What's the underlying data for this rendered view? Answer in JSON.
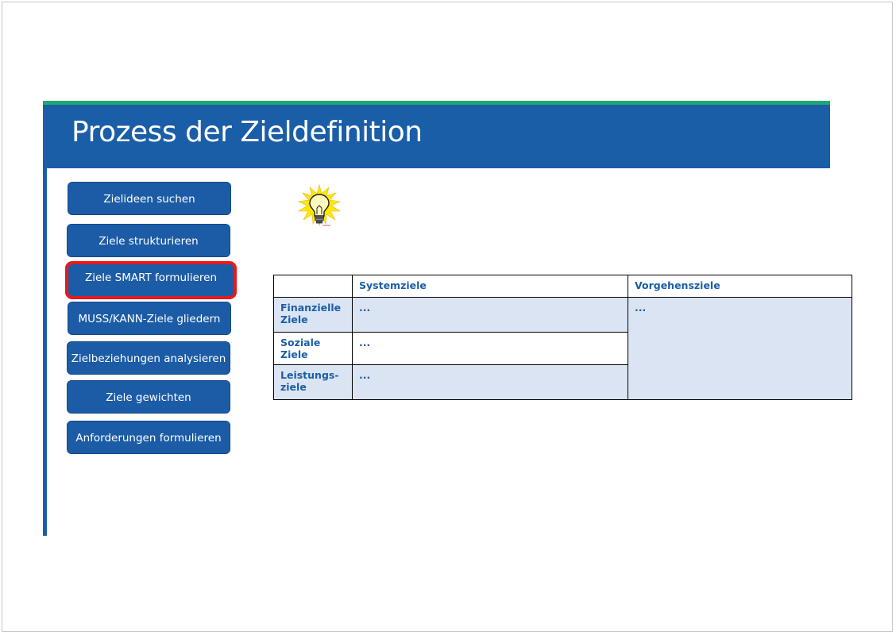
{
  "slide": {
    "title": "Prozess der Zieldefinition"
  },
  "steps": [
    {
      "label": "Zielideen suchen"
    },
    {
      "label": "Ziele strukturieren"
    },
    {
      "label": "Ziele SMART formulieren",
      "active": true
    },
    {
      "label": "MUSS/KANN-Ziele gliedern"
    },
    {
      "label": "Zielbeziehungen analysieren"
    },
    {
      "label": "Ziele gewichten"
    },
    {
      "label": "Anforderungen formulieren"
    }
  ],
  "table": {
    "headers": [
      "",
      "Systemziele",
      "Vorgehensziele"
    ],
    "rows": [
      {
        "label_line1": "Finanzielle",
        "label_line2": "Ziele",
        "system": "...",
        "vorgehen": "..."
      },
      {
        "label_line1": "Soziale Ziele",
        "label_line2": "",
        "system": "..."
      },
      {
        "label_line1": "Leistungs-",
        "label_line2": "ziele",
        "system": "..."
      }
    ]
  },
  "icons": {
    "lightbulb": "lightbulb-icon"
  },
  "colors": {
    "title_bar": "#1a5ea8",
    "accent_strip": "#1fa870",
    "button": "#1c5ca6",
    "active_outline": "#e8191a",
    "table_shade": "#dbe4f3"
  }
}
